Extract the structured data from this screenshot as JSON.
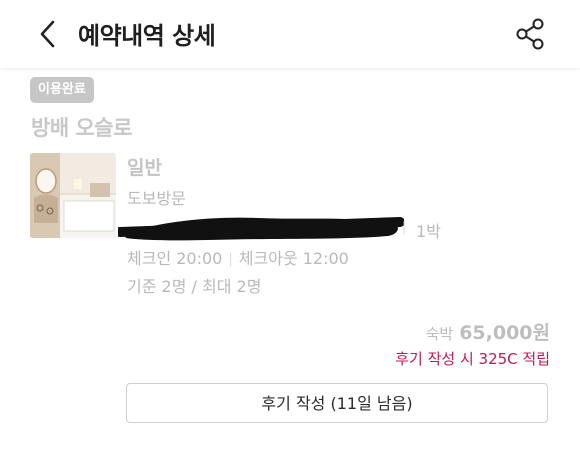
{
  "header": {
    "title": "예약내역 상세",
    "back_icon": "chevron-left-icon",
    "share_icon": "share-icon"
  },
  "reservation": {
    "status": "이용완료",
    "hotel_name": "방배 오슬로",
    "room_name": "일반",
    "visit_type": "도보방문",
    "nights": "1박",
    "checkin": "체크인 20:00",
    "checkout": "체크아웃 12:00",
    "capacity": "기준 2명 / 최대 2명"
  },
  "price": {
    "label": "숙박",
    "value": "65,000원",
    "reward_text": "후기 작성 시 325C 적립"
  },
  "actions": {
    "review_button": "후기 작성 (11일 남음)"
  },
  "colors": {
    "accent": "#c2185b",
    "badge_bg": "#c6c6c6"
  }
}
